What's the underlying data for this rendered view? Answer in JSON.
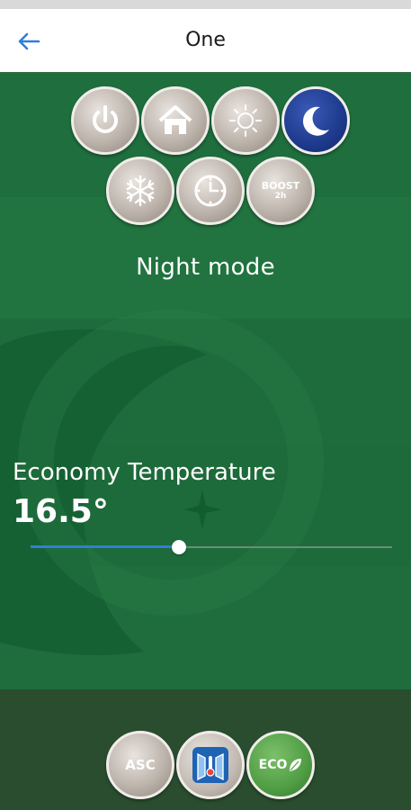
{
  "header": {
    "title": "One",
    "back_icon": "arrow-left-icon"
  },
  "colors": {
    "accent": "#2f7fd8",
    "background": "#1f6b3c",
    "active_mode": "#1d3a8c"
  },
  "modes": [
    {
      "icon": "power-icon",
      "active": false
    },
    {
      "icon": "home-icon",
      "active": false
    },
    {
      "icon": "sun-icon",
      "active": false
    },
    {
      "icon": "moon-icon",
      "active": true
    },
    {
      "icon": "snowflake-icon",
      "active": false
    },
    {
      "icon": "clock-icon",
      "active": false
    },
    {
      "icon": "boost-icon",
      "active": false,
      "label": "BOOST",
      "sublabel": "2h"
    }
  ],
  "current_mode": "Night mode",
  "temperature": {
    "label": "Economy Temperature",
    "value": "16.5°",
    "slider_fraction": 0.41
  },
  "bottom_buttons": [
    {
      "icon": "asc-icon",
      "label": "ASC"
    },
    {
      "icon": "window-thermometer-icon"
    },
    {
      "icon": "eco-leaf-icon",
      "label": "ECO"
    }
  ]
}
